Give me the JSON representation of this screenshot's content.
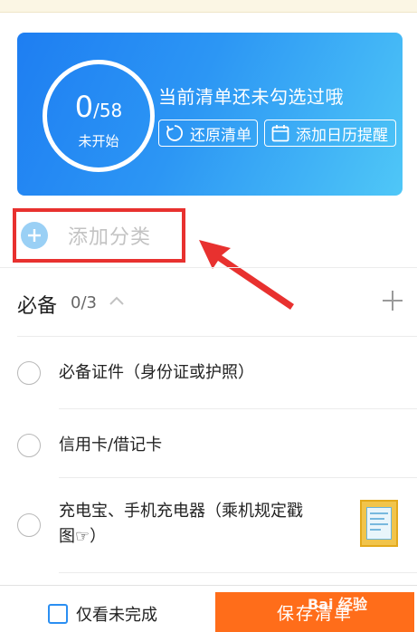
{
  "hero": {
    "done_count": "0",
    "total": "/58",
    "status": "未开始",
    "title": "当前清单还未勾选过哦",
    "restore_label": "还原清单",
    "calendar_label": "添加日历提醒"
  },
  "add_category": {
    "label": "添加分类"
  },
  "section": {
    "title": "必备",
    "count": "0/3"
  },
  "items": [
    {
      "label": "必备证件（身份证或护照）"
    },
    {
      "label": "信用卡/借记卡"
    },
    {
      "label_line1": "充电宝、手机充电器（乘机规定戳",
      "label_line2": "图☞）"
    }
  ],
  "bottom": {
    "only_unfinished_label": "仅看未完成",
    "save_label": "保存清单"
  },
  "watermark": "Bai 经验",
  "colors": {
    "hero_gradient_start": "#1e7ef2",
    "hero_gradient_end": "#4fc7f7",
    "highlight_box": "#e8312f",
    "save_button": "#ff6d1a",
    "checkbox_accent": "#2b8ff2"
  },
  "icons": [
    "restore-icon",
    "calendar-icon",
    "plus-circle-icon",
    "chevron-up-icon",
    "plus-icon",
    "checkbox-icon"
  ]
}
